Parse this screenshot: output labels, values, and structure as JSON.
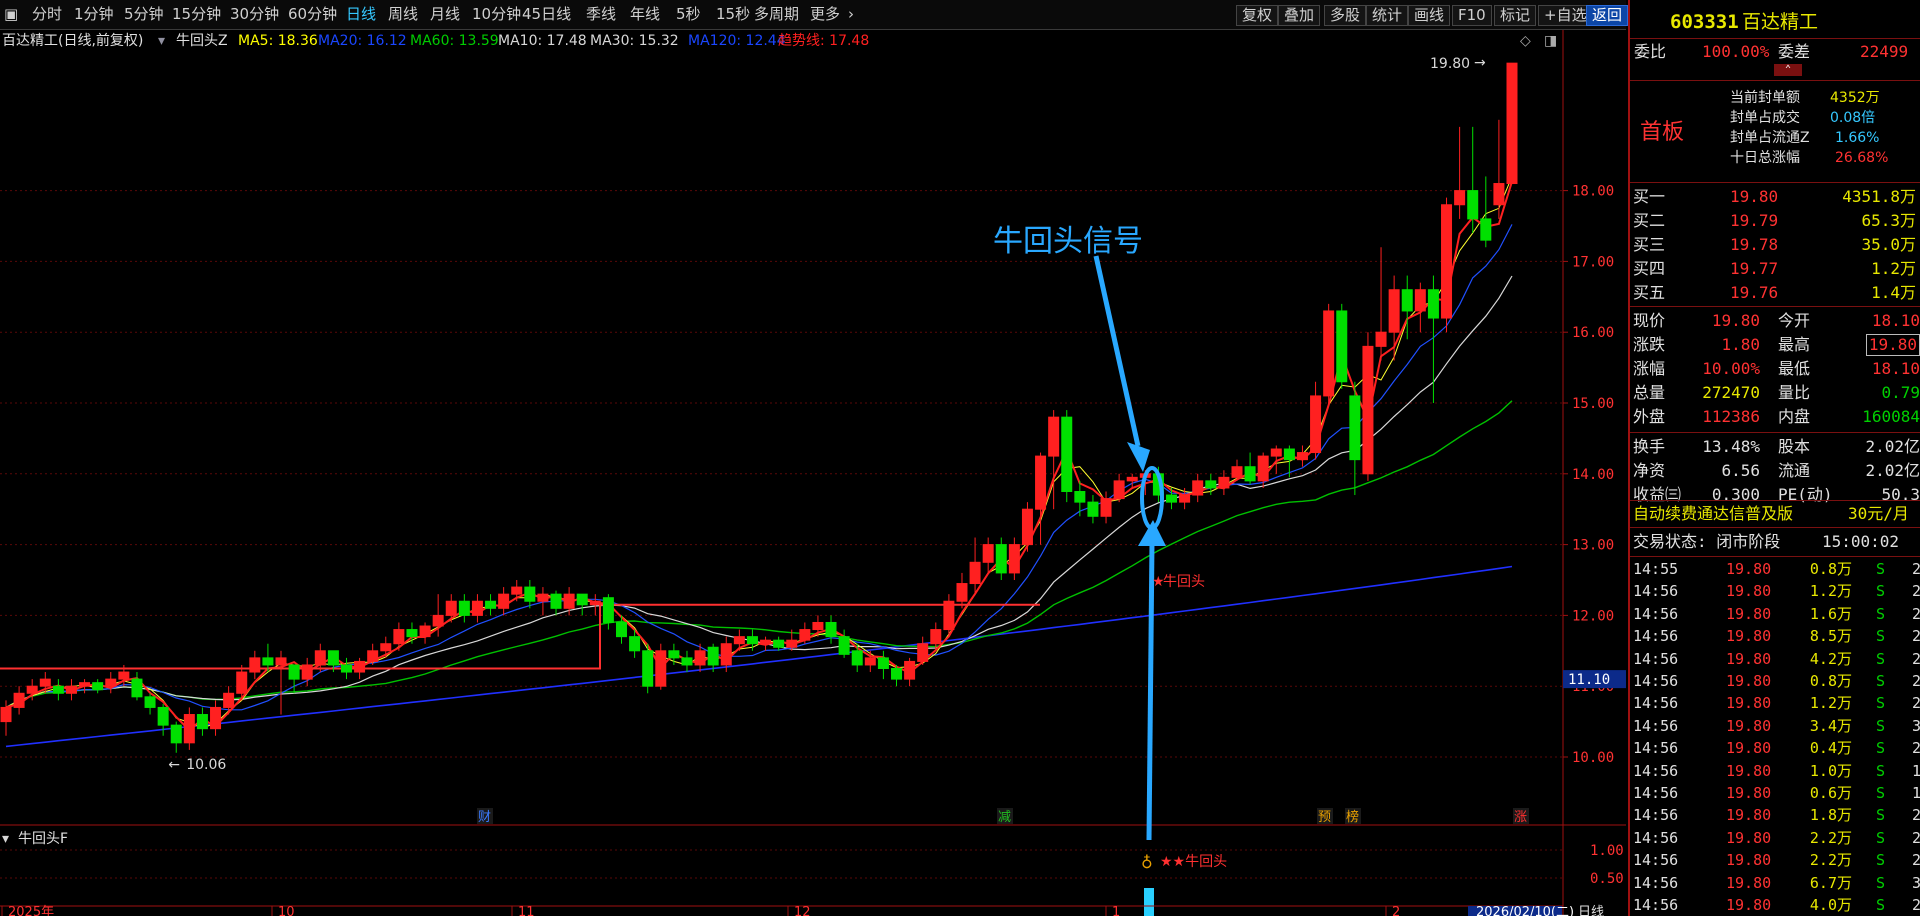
{
  "toolbar": {
    "left_items": [
      "分时",
      "1分钟",
      "5分钟",
      "15分钟",
      "30分钟",
      "60分钟",
      "日线",
      "周线",
      "月线",
      "10分钟",
      "45日线",
      "季线",
      "年线",
      "5秒",
      "15秒",
      "多周期",
      "更多"
    ],
    "active": "日线",
    "right_items": [
      "复权",
      "叠加",
      "多股",
      "统计",
      "画线",
      "F10",
      "标记",
      "+自选",
      "返回"
    ]
  },
  "legend": {
    "title": "百达精工(日线,前复权)",
    "indicator": "牛回头Z",
    "ma": [
      {
        "label": "MA5: 18.36",
        "color": "#ffff00"
      },
      {
        "label": "MA20: 16.12",
        "color": "#1a46ff"
      },
      {
        "label": "MA60: 13.59",
        "color": "#00cc00"
      },
      {
        "label": "MA10: 17.48",
        "color": "#d8d8d8"
      },
      {
        "label": "MA30: 15.32",
        "color": "#d8d8d8"
      },
      {
        "label": "MA120: 12.44",
        "color": "#1a46ff"
      },
      {
        "label": "趋势线: 17.48",
        "color": "#ff2020"
      }
    ]
  },
  "chart_data": {
    "type": "candlestick",
    "title": "百达精工(日线,前复权)",
    "y_axis_ticks": [
      "18.00",
      "17.00",
      "16.00",
      "15.00",
      "14.00",
      "13.00",
      "12.00",
      "11.00",
      "10.00"
    ],
    "ylim": [
      9.0,
      20.3
    ],
    "current_price_tag": "11.10",
    "high_label": "19.80",
    "low_label": "10.06",
    "annotation": "牛回头信号",
    "marker_label": "牛回头",
    "event_markers": [
      "财",
      "减",
      "预",
      "榜",
      "涨"
    ],
    "x_axis_labels": [
      "2025年",
      "10",
      "11",
      "12",
      "1",
      "2",
      "2026/02/10(二)"
    ],
    "period_label": "日线",
    "candles": [
      [
        10.5,
        10.7,
        10.3,
        10.8
      ],
      [
        10.7,
        10.9,
        10.6,
        11.0
      ],
      [
        10.9,
        11.0,
        10.8,
        11.1
      ],
      [
        11.0,
        11.1,
        10.9,
        11.2
      ],
      [
        11.0,
        10.9,
        10.8,
        11.1
      ],
      [
        10.9,
        11.0,
        10.8,
        11.1
      ],
      [
        11.0,
        11.05,
        10.9,
        11.1
      ],
      [
        11.05,
        10.95,
        10.9,
        11.1
      ],
      [
        11.0,
        11.1,
        10.9,
        11.2
      ],
      [
        11.1,
        11.2,
        11.0,
        11.3
      ],
      [
        11.1,
        10.85,
        10.8,
        11.2
      ],
      [
        10.85,
        10.7,
        10.6,
        10.9
      ],
      [
        10.7,
        10.45,
        10.3,
        10.75
      ],
      [
        10.45,
        10.2,
        10.06,
        10.5
      ],
      [
        10.2,
        10.6,
        10.1,
        10.7
      ],
      [
        10.6,
        10.4,
        10.3,
        10.7
      ],
      [
        10.4,
        10.7,
        10.3,
        10.8
      ],
      [
        10.7,
        10.9,
        10.6,
        11.0
      ],
      [
        10.9,
        11.2,
        10.8,
        11.3
      ],
      [
        11.2,
        11.4,
        11.1,
        11.5
      ],
      [
        11.4,
        11.3,
        11.2,
        11.6
      ],
      [
        11.3,
        11.4,
        10.6,
        11.5
      ],
      [
        11.3,
        11.1,
        10.9,
        11.3
      ],
      [
        11.1,
        11.3,
        11.0,
        11.4
      ],
      [
        11.3,
        11.5,
        11.2,
        11.6
      ],
      [
        11.5,
        11.3,
        11.2,
        11.5
      ],
      [
        11.3,
        11.2,
        11.1,
        11.4
      ],
      [
        11.2,
        11.35,
        11.1,
        11.4
      ],
      [
        11.35,
        11.5,
        11.3,
        11.6
      ],
      [
        11.5,
        11.6,
        11.4,
        11.7
      ],
      [
        11.6,
        11.8,
        11.5,
        11.9
      ],
      [
        11.8,
        11.7,
        11.6,
        11.9
      ],
      [
        11.7,
        11.85,
        11.6,
        11.9
      ],
      [
        11.85,
        12.0,
        11.7,
        12.3
      ],
      [
        12.0,
        12.2,
        11.9,
        12.3
      ],
      [
        12.2,
        12.0,
        11.9,
        12.3
      ],
      [
        12.0,
        12.2,
        11.9,
        12.3
      ],
      [
        12.2,
        12.1,
        12.0,
        12.3
      ],
      [
        12.1,
        12.3,
        12.0,
        12.4
      ],
      [
        12.3,
        12.4,
        12.2,
        12.5
      ],
      [
        12.4,
        12.2,
        12.1,
        12.5
      ],
      [
        12.2,
        12.3,
        12.0,
        12.4
      ],
      [
        12.3,
        12.1,
        12.0,
        12.35
      ],
      [
        12.1,
        12.3,
        12.0,
        12.4
      ],
      [
        12.3,
        12.15,
        12.0,
        12.3
      ],
      [
        12.15,
        12.2,
        12.0,
        12.3
      ],
      [
        12.25,
        11.9,
        11.8,
        12.3
      ],
      [
        11.9,
        11.7,
        11.6,
        12.0
      ],
      [
        11.7,
        11.5,
        11.4,
        11.8
      ],
      [
        11.5,
        11.0,
        10.9,
        11.6
      ],
      [
        11.0,
        11.5,
        10.95,
        11.6
      ],
      [
        11.5,
        11.4,
        11.3,
        11.6
      ],
      [
        11.4,
        11.3,
        11.2,
        11.5
      ],
      [
        11.3,
        11.5,
        11.2,
        11.6
      ],
      [
        11.55,
        11.3,
        11.2,
        11.6
      ],
      [
        11.3,
        11.6,
        11.2,
        11.7
      ],
      [
        11.6,
        11.7,
        11.5,
        11.8
      ],
      [
        11.7,
        11.6,
        11.5,
        11.8
      ],
      [
        11.6,
        11.65,
        11.5,
        11.7
      ],
      [
        11.65,
        11.55,
        11.5,
        11.7
      ],
      [
        11.55,
        11.65,
        11.5,
        11.8
      ],
      [
        11.65,
        11.8,
        11.6,
        11.9
      ],
      [
        11.8,
        11.9,
        11.7,
        12.0
      ],
      [
        11.9,
        11.7,
        11.6,
        12.0
      ],
      [
        11.7,
        11.45,
        11.4,
        11.8
      ],
      [
        11.5,
        11.3,
        11.2,
        11.6
      ],
      [
        11.3,
        11.4,
        11.2,
        11.5
      ],
      [
        11.4,
        11.25,
        11.1,
        11.5
      ],
      [
        11.25,
        11.1,
        11.0,
        11.3
      ],
      [
        11.1,
        11.35,
        11.0,
        11.4
      ],
      [
        11.35,
        11.6,
        11.3,
        11.7
      ],
      [
        11.6,
        11.8,
        11.5,
        11.9
      ],
      [
        11.8,
        12.2,
        11.7,
        12.3
      ],
      [
        12.2,
        12.45,
        12.1,
        12.6
      ],
      [
        12.45,
        12.75,
        12.3,
        13.1
      ],
      [
        12.75,
        13.0,
        12.6,
        13.1
      ],
      [
        13.0,
        12.6,
        12.5,
        13.1
      ],
      [
        12.6,
        13.0,
        12.5,
        13.1
      ],
      [
        13.0,
        13.5,
        12.9,
        13.6
      ],
      [
        13.5,
        14.25,
        13.0,
        14.3
      ],
      [
        14.25,
        14.8,
        13.5,
        14.9
      ],
      [
        14.8,
        13.75,
        13.6,
        14.9
      ],
      [
        13.75,
        13.6,
        13.4,
        13.9
      ],
      [
        13.6,
        13.4,
        13.3,
        13.7
      ],
      [
        13.4,
        13.65,
        13.3,
        13.75
      ],
      [
        13.65,
        13.9,
        13.6,
        14.0
      ],
      [
        13.9,
        13.95,
        13.8,
        14.0
      ],
      [
        13.95,
        14.0,
        13.7,
        14.05
      ],
      [
        14.0,
        13.7,
        13.6,
        14.1
      ],
      [
        13.7,
        13.6,
        13.5,
        13.8
      ],
      [
        13.6,
        13.7,
        13.5,
        13.8
      ],
      [
        13.7,
        13.9,
        13.6,
        14.0
      ],
      [
        13.9,
        13.8,
        13.7,
        14.0
      ],
      [
        13.8,
        13.95,
        13.7,
        14.05
      ],
      [
        13.95,
        14.1,
        13.9,
        14.2
      ],
      [
        14.1,
        13.9,
        13.85,
        14.3
      ],
      [
        13.9,
        14.25,
        13.8,
        14.3
      ],
      [
        14.25,
        14.35,
        14.0,
        14.4
      ],
      [
        14.35,
        14.2,
        13.95,
        14.4
      ],
      [
        14.2,
        14.3,
        14.1,
        14.4
      ],
      [
        14.3,
        15.1,
        14.2,
        15.3
      ],
      [
        15.1,
        16.3,
        15.0,
        16.4
      ],
      [
        16.3,
        15.3,
        15.2,
        16.4
      ],
      [
        15.1,
        14.2,
        13.7,
        15.3
      ],
      [
        14.0,
        15.8,
        13.9,
        16.0
      ],
      [
        15.8,
        16.0,
        15.6,
        17.2
      ],
      [
        16.0,
        16.6,
        15.6,
        16.8
      ],
      [
        16.6,
        16.3,
        15.9,
        16.8
      ],
      [
        16.3,
        16.6,
        16.0,
        16.7
      ],
      [
        16.6,
        16.2,
        15.0,
        16.8
      ],
      [
        16.2,
        17.8,
        16.0,
        17.9
      ],
      [
        17.8,
        18.0,
        17.6,
        18.9
      ],
      [
        18.0,
        17.6,
        17.4,
        18.9
      ],
      [
        17.6,
        17.3,
        17.2,
        18.2
      ],
      [
        17.8,
        18.1,
        17.6,
        19.0
      ],
      [
        18.1,
        19.8,
        18.1,
        19.8
      ]
    ]
  },
  "lower_panel": {
    "indicator": "牛回头F",
    "ticks": [
      "1.00",
      "0.50"
    ],
    "signal_label": "★★牛回头"
  },
  "side": {
    "code": "603331",
    "name": "百达精工",
    "weibi_label": "委比",
    "weibi_value": "100.00%",
    "weicha_label": "委差",
    "weicha_value": "22499",
    "board_label": "首板",
    "seal_info": [
      {
        "label": "当前封单额",
        "value": "4352万",
        "color": "#e8e800"
      },
      {
        "label": "封单占成交",
        "value": "0.08倍",
        "color": "#35c8ff"
      },
      {
        "label": "封单占流通Z",
        "value": "1.66%",
        "color": "#35c8ff"
      },
      {
        "label": "十日总涨幅",
        "value": "26.68%",
        "color": "#ff3232"
      }
    ],
    "bids": [
      {
        "label": "买一",
        "price": "19.80",
        "vol": "4351.8万"
      },
      {
        "label": "买二",
        "price": "19.79",
        "vol": "65.3万"
      },
      {
        "label": "买三",
        "price": "19.78",
        "vol": "35.0万"
      },
      {
        "label": "买四",
        "price": "19.77",
        "vol": "1.2万"
      },
      {
        "label": "买五",
        "price": "19.76",
        "vol": "1.4万"
      }
    ],
    "stats": [
      {
        "l1": "现价",
        "v1": "19.80",
        "c1": "#ff3232",
        "l2": "今开",
        "v2": "18.10",
        "c2": "#ff3232",
        "box": false
      },
      {
        "l1": "涨跌",
        "v1": "1.80",
        "c1": "#ff3232",
        "l2": "最高",
        "v2": "19.80",
        "c2": "#ff3232",
        "box": true
      },
      {
        "l1": "涨幅",
        "v1": "10.00%",
        "c1": "#ff3232",
        "l2": "最低",
        "v2": "18.10",
        "c2": "#ff3232",
        "box": false
      },
      {
        "l1": "总量",
        "v1": "272470",
        "c1": "#e8e800",
        "l2": "量比",
        "v2": "0.79",
        "c2": "#00d000",
        "box": false
      },
      {
        "l1": "外盘",
        "v1": "112386",
        "c1": "#ff3232",
        "l2": "内盘",
        "v2": "160084",
        "c2": "#00d000",
        "box": false
      },
      {
        "l1": "换手",
        "v1": "13.48%",
        "c1": "#e0e0e0",
        "l2": "股本",
        "v2": "2.02亿",
        "c2": "#e0e0e0",
        "box": false
      },
      {
        "l1": "净资",
        "v1": "6.56",
        "c1": "#e0e0e0",
        "l2": "流通",
        "v2": "2.02亿",
        "c2": "#e0e0e0",
        "box": false
      },
      {
        "l1": "收益㈢",
        "v1": "0.300",
        "c1": "#e0e0e0",
        "l2": "PE(动)",
        "v2": "50.3",
        "c2": "#e0e0e0",
        "box": false
      }
    ],
    "promo": "自动续费通达信普及版",
    "promo_price": "30元/月",
    "trade_status": "交易状态: 闭市阶段",
    "trade_time": "15:00:02",
    "ticks": [
      {
        "t": "14:55",
        "p": "19.80",
        "v": "0.8万",
        "s": "S",
        "n": "2"
      },
      {
        "t": "14:56",
        "p": "19.80",
        "v": "1.2万",
        "s": "S",
        "n": "2"
      },
      {
        "t": "14:56",
        "p": "19.80",
        "v": "1.6万",
        "s": "S",
        "n": "2"
      },
      {
        "t": "14:56",
        "p": "19.80",
        "v": "8.5万",
        "s": "S",
        "n": "2"
      },
      {
        "t": "14:56",
        "p": "19.80",
        "v": "4.2万",
        "s": "S",
        "n": "2"
      },
      {
        "t": "14:56",
        "p": "19.80",
        "v": "0.8万",
        "s": "S",
        "n": "2"
      },
      {
        "t": "14:56",
        "p": "19.80",
        "v": "1.2万",
        "s": "S",
        "n": "2"
      },
      {
        "t": "14:56",
        "p": "19.80",
        "v": "3.4万",
        "s": "S",
        "n": "3"
      },
      {
        "t": "14:56",
        "p": "19.80",
        "v": "0.4万",
        "s": "S",
        "n": "2"
      },
      {
        "t": "14:56",
        "p": "19.80",
        "v": "1.0万",
        "s": "S",
        "n": "1"
      },
      {
        "t": "14:56",
        "p": "19.80",
        "v": "0.6万",
        "s": "S",
        "n": "1"
      },
      {
        "t": "14:56",
        "p": "19.80",
        "v": "1.8万",
        "s": "S",
        "n": "2"
      },
      {
        "t": "14:56",
        "p": "19.80",
        "v": "2.2万",
        "s": "S",
        "n": "2"
      },
      {
        "t": "14:56",
        "p": "19.80",
        "v": "2.2万",
        "s": "S",
        "n": "2"
      },
      {
        "t": "14:56",
        "p": "19.80",
        "v": "6.7万",
        "s": "S",
        "n": "3"
      },
      {
        "t": "14:56",
        "p": "19.80",
        "v": "4.0万",
        "s": "S",
        "n": "2"
      }
    ]
  }
}
